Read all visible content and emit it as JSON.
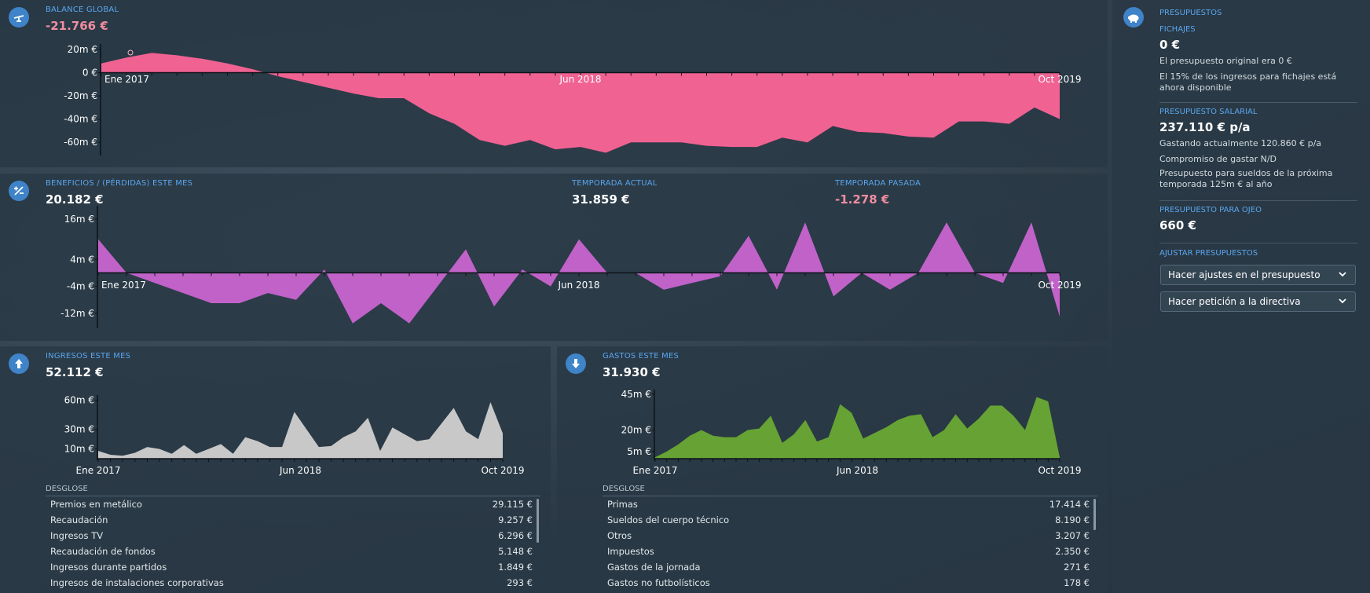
{
  "balance": {
    "title": "BALANCE GLOBAL",
    "value": "-21.766 €",
    "y_ticks": [
      "20m €",
      "0 €",
      "-20m €",
      "-40m €",
      "-60m €"
    ],
    "x_ticks": [
      "Ene 2017",
      "Jun 2018",
      "Oct 2019"
    ]
  },
  "profit": {
    "title": "BENEFICIOS / (PÉRDIDAS) ESTE MES",
    "value": "20.182 €",
    "season_title": "TEMPORADA ACTUAL",
    "season_value": "31.859 €",
    "last_title": "TEMPORADA PASADA",
    "last_value": "-1.278 €",
    "y_ticks": [
      "16m €",
      "4m €",
      "-4m €",
      "-12m €"
    ],
    "x_ticks": [
      "Ene 2017",
      "Jun 2018",
      "Oct 2019"
    ]
  },
  "income": {
    "title": "INGRESOS ESTE MES",
    "value": "52.112 €",
    "y_ticks": [
      "60m €",
      "30m €",
      "10m €"
    ],
    "x_ticks": [
      "Ene 2017",
      "Jun 2018",
      "Oct 2019"
    ],
    "breakdown_title": "DESGLOSE",
    "rows": [
      {
        "label": "Premios en metálico",
        "value": "29.115 €"
      },
      {
        "label": "Recaudación",
        "value": "9.257 €"
      },
      {
        "label": "Ingresos TV",
        "value": "6.296 €"
      },
      {
        "label": "Recaudación de fondos",
        "value": "5.148 €"
      },
      {
        "label": "Ingresos durante partidos",
        "value": "1.849 €"
      },
      {
        "label": "Ingresos de instalaciones corporativas",
        "value": "293 €"
      }
    ]
  },
  "expenses": {
    "title": "GASTOS ESTE MES",
    "value": "31.930 €",
    "y_ticks": [
      "45m €",
      "20m €",
      "5m €"
    ],
    "x_ticks": [
      "Ene 2017",
      "Jun 2018",
      "Oct 2019"
    ],
    "breakdown_title": "DESGLOSE",
    "rows": [
      {
        "label": "Primas",
        "value": "17.414 €"
      },
      {
        "label": "Sueldos del cuerpo técnico",
        "value": "8.190 €"
      },
      {
        "label": "Otros",
        "value": "3.207 €"
      },
      {
        "label": "Impuestos",
        "value": "2.350 €"
      },
      {
        "label": "Gastos de la jornada",
        "value": "271 €"
      },
      {
        "label": "Gastos no futbolísticos",
        "value": "178 €"
      }
    ]
  },
  "budgets": {
    "title": "PRESUPUESTOS",
    "transfers_title": "FICHAJES",
    "transfers_value": "0 €",
    "transfers_note1": "El presupuesto original era 0 €",
    "transfers_note2": "El 15% de los ingresos para fichajes está ahora disponible",
    "wage_title": "PRESUPUESTO SALARIAL",
    "wage_value": "237.110 € p/a",
    "wage_note1": "Gastando actualmente 120.860 € p/a",
    "wage_note2": "Compromiso de gastar N/D",
    "wage_note3": "Presupuesto para sueldos de la próxima temporada 125m € al año",
    "scout_title": "PRESUPUESTO PARA OJEO",
    "scout_value": "660 €",
    "adjust_title": "AJUSTAR PRESUPUESTOS",
    "dropdown1": "Hacer ajustes en el presupuesto",
    "dropdown2": "Hacer petición a la directiva"
  },
  "colors": {
    "balance_fill": "#f06292",
    "profit_fill": "#c062c8",
    "income_fill": "#c8c8c8",
    "expenses_fill": "#67a234",
    "accent": "#5aa6f0",
    "negative": "#f08da0"
  },
  "chart_data": [
    {
      "type": "area",
      "title": "BALANCE GLOBAL",
      "x_ticks": [
        "Ene 2017",
        "Jun 2018",
        "Oct 2019"
      ],
      "ylim": [
        -70,
        22
      ],
      "y_tick_values": [
        20,
        0,
        -20,
        -40,
        -60
      ],
      "values": [
        8,
        13,
        17,
        15,
        12,
        8,
        3,
        -3,
        -8,
        -13,
        -18,
        -22,
        -22,
        -35,
        -44,
        -58,
        -63,
        -58,
        -66,
        -64,
        -69,
        -60,
        -60,
        -60,
        -63,
        -64,
        -64,
        -56,
        -60,
        -46,
        -51,
        -52,
        -55,
        -56,
        -42,
        -42,
        -44,
        -30,
        -40
      ]
    },
    {
      "type": "area",
      "title": "BENEFICIOS / (PÉRDIDAS) ESTE MES",
      "x_ticks": [
        "Ene 2017",
        "Jun 2018",
        "Oct 2019"
      ],
      "ylim": [
        -16,
        19
      ],
      "y_tick_values": [
        16,
        4,
        -4,
        -12
      ],
      "values": [
        10,
        0,
        -3,
        -6,
        -9,
        -9,
        -6,
        -8,
        1,
        -15,
        -9,
        -15,
        -4,
        7,
        -10,
        1,
        -4,
        10,
        0,
        0,
        -5,
        -3,
        -1,
        11,
        -5,
        15,
        -7,
        0,
        -5,
        0,
        15,
        0,
        -3,
        15,
        -13
      ]
    },
    {
      "type": "area",
      "title": "INGRESOS ESTE MES",
      "x_ticks": [
        "Ene 2017",
        "Jun 2018",
        "Oct 2019"
      ],
      "ylim": [
        0,
        62
      ],
      "y_tick_values": [
        60,
        30,
        10
      ],
      "values": [
        8,
        4,
        3,
        6,
        12,
        10,
        5,
        14,
        5,
        10,
        15,
        5,
        22,
        18,
        12,
        12,
        48,
        30,
        12,
        13,
        22,
        28,
        42,
        8,
        32,
        25,
        18,
        20,
        36,
        52,
        28,
        20,
        58,
        26
      ]
    },
    {
      "type": "area",
      "title": "GASTOS ESTE MES",
      "x_ticks": [
        "Ene 2017",
        "Jun 2018",
        "Oct 2019"
      ],
      "ylim": [
        0,
        46
      ],
      "y_tick_values": [
        45,
        20,
        5
      ],
      "values": [
        1,
        5,
        10,
        16,
        20,
        16,
        15,
        15,
        20,
        21,
        30,
        11,
        17,
        27,
        12,
        15,
        38,
        32,
        14,
        18,
        22,
        27,
        30,
        31,
        15,
        20,
        31,
        21,
        28,
        37,
        37,
        30,
        20,
        43,
        40,
        1
      ]
    }
  ]
}
